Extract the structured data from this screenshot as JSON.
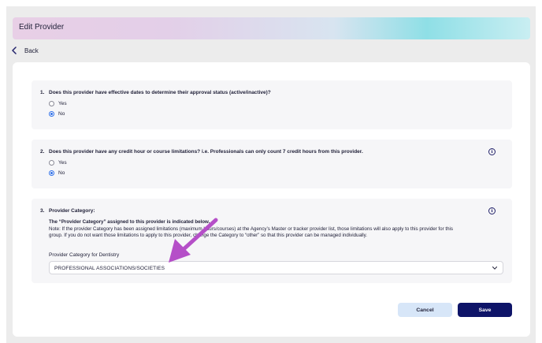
{
  "header": {
    "title": "Edit Provider"
  },
  "nav": {
    "back_label": "Back"
  },
  "questions": [
    {
      "number": "1.",
      "text": "Does this provider have effective dates to determine their approval status (active/inactive)?",
      "options": [
        {
          "label": "Yes",
          "checked": false
        },
        {
          "label": "No",
          "checked": true
        }
      ]
    },
    {
      "number": "2.",
      "text": "Does this provider have any credit hour or course limitations? i.e. Professionals can only count 7 credit hours from this provider.",
      "options": [
        {
          "label": "Yes",
          "checked": false
        },
        {
          "label": "No",
          "checked": true
        }
      ]
    },
    {
      "number": "3.",
      "text": "Provider Category:",
      "note_line1": "The “Provider Category” assigned to this provider is indicated below.",
      "note_line2": "Note: If the provider Category has been assigned limitations (maximum hours/courses) at the Agency’s Master or tracker provider list, those limitations will also apply to this provider for this",
      "note_line3": "group. If you do not want those limitations to apply to this provider, change the Category to “other” so that this provider can be managed individually.",
      "select_label": "Provider Category for Dentistry",
      "select_value": "PROFESSIONAL ASSOCIATIONS/SOCIETIES"
    }
  ],
  "info_icon_glyph": "i",
  "actions": {
    "cancel_label": "Cancel",
    "save_label": "Save"
  },
  "colors": {
    "primary": "#0e1468",
    "cancel_bg": "#d7e6f8",
    "radio_checked": "#2f6fe8",
    "annotation_arrow": "#b54fc8"
  },
  "icons": [
    "chevron-left-icon",
    "info-icon",
    "chevron-down-icon",
    "annotation-arrow-icon"
  ]
}
